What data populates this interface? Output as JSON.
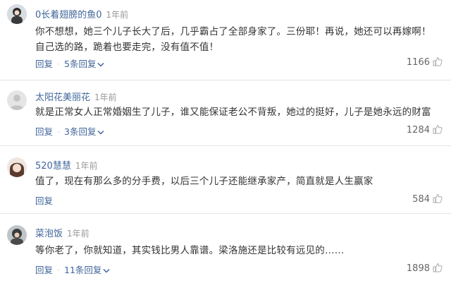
{
  "comments": [
    {
      "username": "0长着翅膀的鱼0",
      "time": "1年前",
      "text": "你不想想，她三个儿子长大了后，几乎霸占了全部身家了。三份耶！再说，她还可以再嫁啊！自己选的路，跪着也要走完，没有值不值！",
      "reply_label": "回复",
      "reply_count": "5条回复",
      "likes": "1166"
    },
    {
      "username": "太阳花美丽花",
      "time": "1年前",
      "text": "就是正常女人正常婚姻生了儿子，谁又能保证老公不背叛，她过的挺好，儿子是她永远的财富",
      "reply_label": "回复",
      "reply_count": "3条回复",
      "likes": "1284"
    },
    {
      "username": "520慧慧",
      "time": "1年前",
      "text": "值了，现在有那么多的分手费，以后三个儿子还能继承家产，简直就是人生赢家",
      "reply_label": "回复",
      "reply_count": "",
      "likes": "584"
    },
    {
      "username": "菜泡饭",
      "time": "1年前",
      "text": "等你老了，你就知道，其实钱比男人靠谱。梁洛施还是比较有远见的……",
      "reply_label": "回复",
      "reply_count": "11条回复",
      "likes": "1898"
    }
  ],
  "colors": {
    "link": "#406599",
    "meta": "#999999",
    "text": "#333333",
    "divider": "#e6e6e6"
  }
}
